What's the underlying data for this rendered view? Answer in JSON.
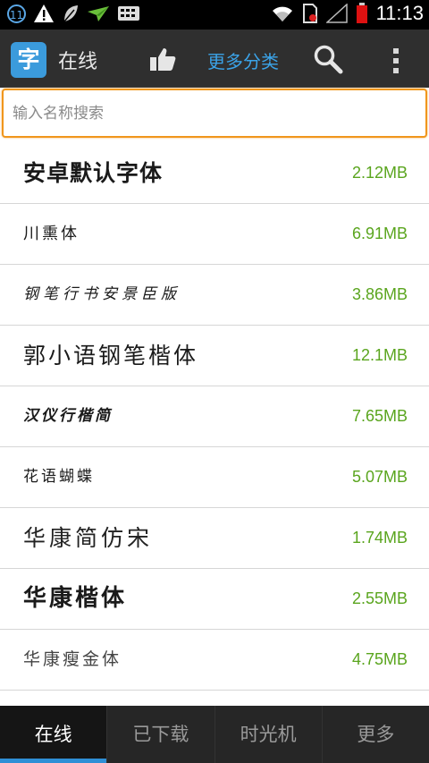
{
  "status_bar": {
    "notification_count": "11",
    "time": "11:13"
  },
  "action_bar": {
    "logo_char": "字",
    "title": "在线",
    "more_categories": "更多分类"
  },
  "search": {
    "placeholder": "输入名称搜索",
    "value": ""
  },
  "fonts": [
    {
      "name": "安卓默认字体",
      "size": "2.12MB"
    },
    {
      "name": "川熏体",
      "size": "6.91MB"
    },
    {
      "name": "钢笔行书安景臣版",
      "size": "3.86MB"
    },
    {
      "name": "郭小语钢笔楷体",
      "size": "12.1MB"
    },
    {
      "name": "汉仪行楷简",
      "size": "7.65MB"
    },
    {
      "name": "花语蝴蝶",
      "size": "5.07MB"
    },
    {
      "name": "华康简仿宋",
      "size": "1.74MB"
    },
    {
      "name": "华康楷体",
      "size": "2.55MB"
    },
    {
      "name": "华康瘦金体",
      "size": "4.75MB"
    }
  ],
  "tabs": [
    {
      "label": "在线"
    },
    {
      "label": "已下载"
    },
    {
      "label": "时光机"
    },
    {
      "label": "更多"
    }
  ],
  "colors": {
    "accent": "#3ba3e8",
    "size_text": "#5aa51e",
    "search_border": "#f0961c"
  }
}
